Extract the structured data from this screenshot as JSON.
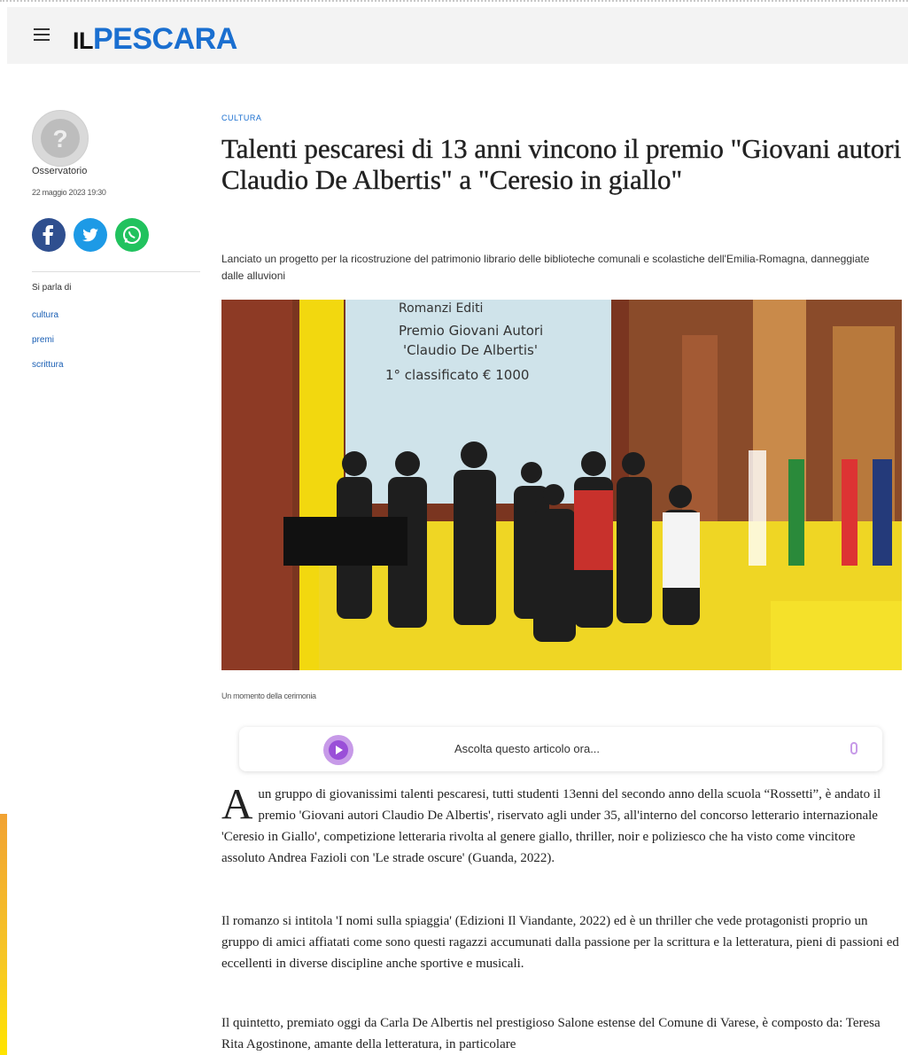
{
  "header": {
    "logo_il": "IL",
    "logo_name": "PESCARA"
  },
  "sidebar": {
    "author": "Osservatorio",
    "date": "22 maggio 2023 19:30",
    "share": [
      "facebook-icon",
      "twitter-icon",
      "whatsapp-icon"
    ],
    "topics_label": "Si parla di",
    "tags": [
      "cultura",
      "premi",
      "scrittura"
    ]
  },
  "article": {
    "section": "CULTURA",
    "title": "Talenti pescaresi di 13 anni vincono il premio \"Giovani autori Claudio De Albertis\" a \"Ceresio in giallo\"",
    "subtitle": "Lanciato un progetto per la ricostruzione del patrimonio librario delle biblioteche comunali e scolastiche dell'Emilia-Romagna, danneggiate dalle alluvioni",
    "photo_screen": [
      "Romanzi Editi",
      "Premio Giovani Autori",
      "'Claudio De Albertis'",
      "1° classificato  € 1000"
    ],
    "caption": "Un momento della cerimonia",
    "audio_label": "Ascolta questo articolo ora...",
    "dropcap": "A",
    "p1": "un gruppo di giovanissimi talenti pescaresi, tutti studenti 13enni del secondo anno della scuola “Rossetti”, è andato il premio 'Giovani autori Claudio De Albertis', riservato agli under 35, all'interno del concorso letterario internazionale 'Ceresio in Giallo', competizione letteraria rivolta al genere giallo, thriller, noir e poliziesco che ha visto come vincitore assoluto Andrea Fazioli con 'Le strade oscure' (Guanda, 2022).",
    "p2": "Il romanzo si intitola 'I nomi sulla spiaggia' (Edizioni Il Viandante, 2022) ed è un thriller che vede protagonisti proprio un gruppo di amici affiatati come sono questi ragazzi accumunati dalla passione per la scrittura e la letteratura, pieni di passioni ed eccellenti in diverse discipline anche sportive e musicali.",
    "p3": "Il quintetto, premiato oggi da Carla De Albertis nel prestigioso Salone estense del Comune di Varese, è composto da: Teresa Rita Agostinone, amante della letteratura, in particolare"
  },
  "colors": {
    "brand_blue": "#1a6fd0",
    "facebook": "#2f4f8f",
    "twitter": "#1d9ae6",
    "whatsapp": "#21c25e",
    "audio_purple": "#9a4fd8"
  }
}
